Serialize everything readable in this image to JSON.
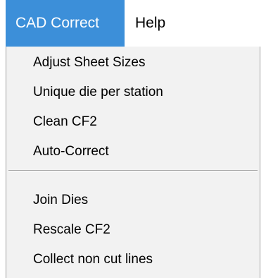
{
  "menubar": {
    "items": [
      {
        "label": "CAD Correct",
        "active": true
      },
      {
        "label": "Help",
        "active": false
      }
    ]
  },
  "dropdown": {
    "group1": [
      "Adjust Sheet Sizes",
      "Unique die per station",
      "Clean CF2",
      "Auto-Correct"
    ],
    "group2": [
      "Join Dies",
      "Rescale CF2",
      "Collect non cut lines"
    ]
  },
  "colors": {
    "active_menu_bg": "#3c8fd9",
    "active_menu_text": "#ffffff",
    "dropdown_bg": "#f2f2f2"
  }
}
